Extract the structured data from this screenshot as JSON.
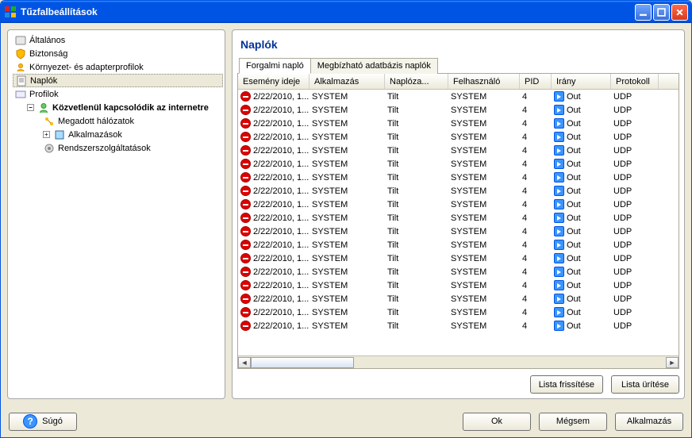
{
  "window": {
    "title": "Tűzfalbeállítások"
  },
  "sidebar": {
    "items": [
      {
        "label": "Általános",
        "icon": "general"
      },
      {
        "label": "Biztonság",
        "icon": "security"
      },
      {
        "label": "Környezet- és adapterprofilok",
        "icon": "profiles"
      },
      {
        "label": "Naplók",
        "icon": "logs",
        "selected": true
      },
      {
        "label": "Profilok",
        "icon": "profiles"
      }
    ],
    "profile_node": {
      "label": "Közvetlenül kapcsolódik az internetre",
      "children": [
        {
          "label": "Megadott hálózatok",
          "icon": "network"
        },
        {
          "label": "Alkalmazások",
          "icon": "apps",
          "expandable": true
        },
        {
          "label": "Rendszerszolgáltatások",
          "icon": "services"
        }
      ]
    }
  },
  "main": {
    "title": "Naplók",
    "tabs": [
      {
        "label": "Forgalmi napló",
        "active": true
      },
      {
        "label": "Megbízható adatbázis naplók",
        "active": false
      }
    ],
    "columns": [
      {
        "label": "Esemény ideje",
        "cls": "c-time"
      },
      {
        "label": "Alkalmazás",
        "cls": "c-app"
      },
      {
        "label": "Naplóza...",
        "cls": "c-log"
      },
      {
        "label": "Felhasználó",
        "cls": "c-user"
      },
      {
        "label": "PID",
        "cls": "c-pid"
      },
      {
        "label": "Irány",
        "cls": "c-dir"
      },
      {
        "label": "Protokoll",
        "cls": "c-proto"
      }
    ],
    "rows": [
      {
        "time": "2/22/2010, 1...",
        "app": "SYSTEM",
        "log": "Tilt",
        "user": "SYSTEM",
        "pid": "4",
        "dir": "Out",
        "proto": "UDP"
      },
      {
        "time": "2/22/2010, 1...",
        "app": "SYSTEM",
        "log": "Tilt",
        "user": "SYSTEM",
        "pid": "4",
        "dir": "Out",
        "proto": "UDP"
      },
      {
        "time": "2/22/2010, 1...",
        "app": "SYSTEM",
        "log": "Tilt",
        "user": "SYSTEM",
        "pid": "4",
        "dir": "Out",
        "proto": "UDP"
      },
      {
        "time": "2/22/2010, 1...",
        "app": "SYSTEM",
        "log": "Tilt",
        "user": "SYSTEM",
        "pid": "4",
        "dir": "Out",
        "proto": "UDP"
      },
      {
        "time": "2/22/2010, 1...",
        "app": "SYSTEM",
        "log": "Tilt",
        "user": "SYSTEM",
        "pid": "4",
        "dir": "Out",
        "proto": "UDP"
      },
      {
        "time": "2/22/2010, 1...",
        "app": "SYSTEM",
        "log": "Tilt",
        "user": "SYSTEM",
        "pid": "4",
        "dir": "Out",
        "proto": "UDP"
      },
      {
        "time": "2/22/2010, 1...",
        "app": "SYSTEM",
        "log": "Tilt",
        "user": "SYSTEM",
        "pid": "4",
        "dir": "Out",
        "proto": "UDP"
      },
      {
        "time": "2/22/2010, 1...",
        "app": "SYSTEM",
        "log": "Tilt",
        "user": "SYSTEM",
        "pid": "4",
        "dir": "Out",
        "proto": "UDP"
      },
      {
        "time": "2/22/2010, 1...",
        "app": "SYSTEM",
        "log": "Tilt",
        "user": "SYSTEM",
        "pid": "4",
        "dir": "Out",
        "proto": "UDP"
      },
      {
        "time": "2/22/2010, 1...",
        "app": "SYSTEM",
        "log": "Tilt",
        "user": "SYSTEM",
        "pid": "4",
        "dir": "Out",
        "proto": "UDP"
      },
      {
        "time": "2/22/2010, 1...",
        "app": "SYSTEM",
        "log": "Tilt",
        "user": "SYSTEM",
        "pid": "4",
        "dir": "Out",
        "proto": "UDP"
      },
      {
        "time": "2/22/2010, 1...",
        "app": "SYSTEM",
        "log": "Tilt",
        "user": "SYSTEM",
        "pid": "4",
        "dir": "Out",
        "proto": "UDP"
      },
      {
        "time": "2/22/2010, 1...",
        "app": "SYSTEM",
        "log": "Tilt",
        "user": "SYSTEM",
        "pid": "4",
        "dir": "Out",
        "proto": "UDP"
      },
      {
        "time": "2/22/2010, 1...",
        "app": "SYSTEM",
        "log": "Tilt",
        "user": "SYSTEM",
        "pid": "4",
        "dir": "Out",
        "proto": "UDP"
      },
      {
        "time": "2/22/2010, 1...",
        "app": "SYSTEM",
        "log": "Tilt",
        "user": "SYSTEM",
        "pid": "4",
        "dir": "Out",
        "proto": "UDP"
      },
      {
        "time": "2/22/2010, 1...",
        "app": "SYSTEM",
        "log": "Tilt",
        "user": "SYSTEM",
        "pid": "4",
        "dir": "Out",
        "proto": "UDP"
      },
      {
        "time": "2/22/2010, 1...",
        "app": "SYSTEM",
        "log": "Tilt",
        "user": "SYSTEM",
        "pid": "4",
        "dir": "Out",
        "proto": "UDP"
      },
      {
        "time": "2/22/2010, 1...",
        "app": "SYSTEM",
        "log": "Tilt",
        "user": "SYSTEM",
        "pid": "4",
        "dir": "Out",
        "proto": "UDP"
      }
    ],
    "buttons": {
      "refresh": "Lista frissítése",
      "clear": "Lista ürítése"
    }
  },
  "footer": {
    "help": "Súgó",
    "ok": "Ok",
    "cancel": "Mégsem",
    "apply": "Alkalmazás"
  }
}
